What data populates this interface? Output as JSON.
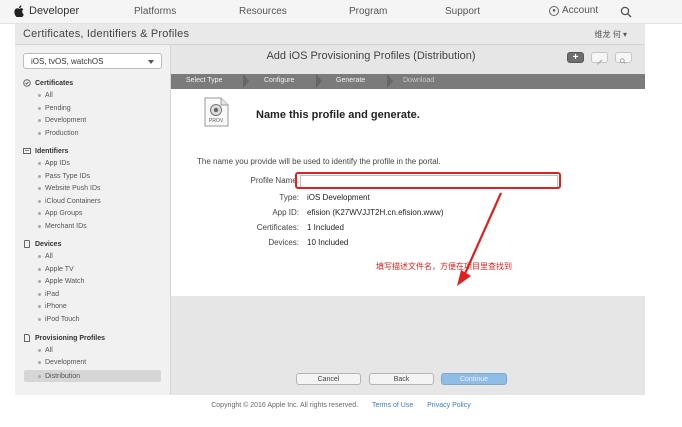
{
  "topnav": {
    "brand": "Developer",
    "links": [
      "Platforms",
      "Resources",
      "Program",
      "Support"
    ],
    "account": "Account"
  },
  "section_header": {
    "title": "Certificates, Identifiers & Profiles",
    "user": "维龙 何 ▾"
  },
  "sidebar": {
    "platform": "iOS, tvOS, watchOS",
    "groups": [
      {
        "label": "Certificates",
        "icon": "certificate-icon",
        "items": [
          "All",
          "Pending",
          "Development",
          "Production"
        ]
      },
      {
        "label": "Identifiers",
        "icon": "id-card-icon",
        "items": [
          "App IDs",
          "Pass Type IDs",
          "Website Push IDs",
          "iCloud Containers",
          "App Groups",
          "Merchant IDs"
        ]
      },
      {
        "label": "Devices",
        "icon": "device-icon",
        "items": [
          "All",
          "Apple TV",
          "Apple Watch",
          "iPad",
          "iPhone",
          "iPod Touch"
        ]
      },
      {
        "label": "Provisioning Profiles",
        "icon": "document-icon",
        "items": [
          "All",
          "Development",
          "Distribution"
        ]
      }
    ],
    "active_item": "Distribution"
  },
  "content": {
    "title": "Add iOS Provisioning Profiles (Distribution)",
    "steps": [
      "Select Type",
      "Configure",
      "Generate",
      "Download"
    ],
    "doc_icon_text": "PROV",
    "heading": "Name this profile and generate.",
    "description": "The name you provide will be used to identify the profile in the portal.",
    "fields": [
      {
        "label": "Profile Name:",
        "value": ""
      },
      {
        "label": "Type:",
        "value": "iOS Development"
      },
      {
        "label": "App ID:",
        "value": "efision (K27WVJJT2H.cn.efision.www)"
      },
      {
        "label": "Certificates:",
        "value": "1 Included"
      },
      {
        "label": "Devices:",
        "value": "10 Included"
      }
    ],
    "annotation": "填写描述文件名，方便在项目里查找到",
    "buttons": {
      "cancel": "Cancel",
      "back": "Back",
      "continue": "Continue"
    }
  },
  "footer": {
    "copyright": "Copyright © 2016 Apple Inc. All rights reserved.",
    "terms": "Terms of Use",
    "privacy": "Privacy Policy"
  },
  "colors": {
    "annotation_red": "#e02020",
    "steps_bar": "#7b7b7b",
    "primary_button": "#8fbde6",
    "link": "#3a7bc8"
  }
}
